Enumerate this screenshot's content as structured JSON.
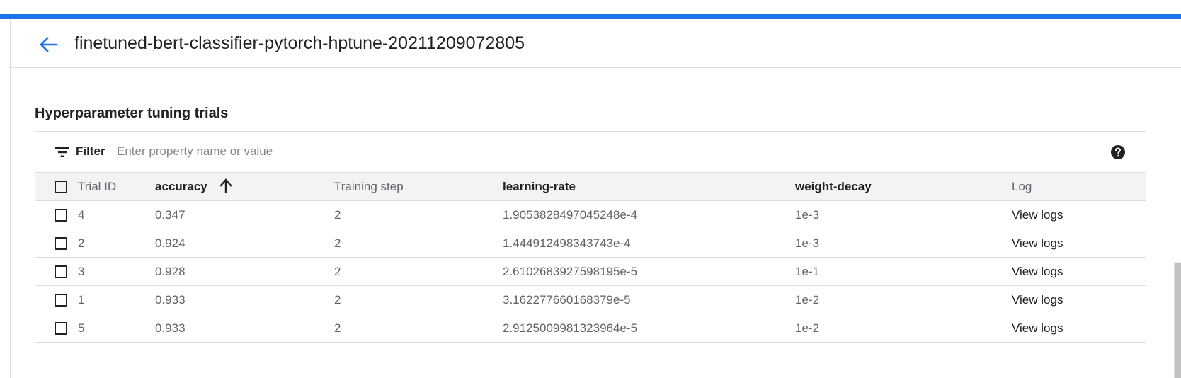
{
  "colors": {
    "accent": "#1a73e8",
    "header_bg": "#f1f3f4",
    "muted_text": "#5f6368",
    "primary_text": "#202124"
  },
  "header": {
    "back_icon": "arrow-back-icon",
    "title": "finetuned-bert-classifier-pytorch-hptune-20211209072805"
  },
  "section": {
    "title": "Hyperparameter tuning trials"
  },
  "filter": {
    "icon": "filter-list-icon",
    "label": "Filter",
    "placeholder": "Enter property name or value",
    "value": "",
    "help_icon": "help-circle-icon"
  },
  "table": {
    "columns": {
      "trial_id": "Trial ID",
      "accuracy": "accuracy",
      "training_step": "Training step",
      "learning_rate": "learning-rate",
      "weight_decay": "weight-decay",
      "log": "Log"
    },
    "sort": {
      "column": "accuracy",
      "direction": "ascending",
      "icon": "arrow-upward-icon"
    },
    "rows": [
      {
        "trial_id": "4",
        "accuracy": "0.347",
        "training_step": "2",
        "learning_rate": "1.9053828497045248e-4",
        "weight_decay": "1e-3",
        "log": "View logs"
      },
      {
        "trial_id": "2",
        "accuracy": "0.924",
        "training_step": "2",
        "learning_rate": "1.444912498343743e-4",
        "weight_decay": "1e-3",
        "log": "View logs"
      },
      {
        "trial_id": "3",
        "accuracy": "0.928",
        "training_step": "2",
        "learning_rate": "2.6102683927598195e-5",
        "weight_decay": "1e-1",
        "log": "View logs"
      },
      {
        "trial_id": "1",
        "accuracy": "0.933",
        "training_step": "2",
        "learning_rate": "3.162277660168379e-5",
        "weight_decay": "1e-2",
        "log": "View logs"
      },
      {
        "trial_id": "5",
        "accuracy": "0.933",
        "training_step": "2",
        "learning_rate": "2.9125009981323964e-5",
        "weight_decay": "1e-2",
        "log": "View logs"
      }
    ]
  }
}
